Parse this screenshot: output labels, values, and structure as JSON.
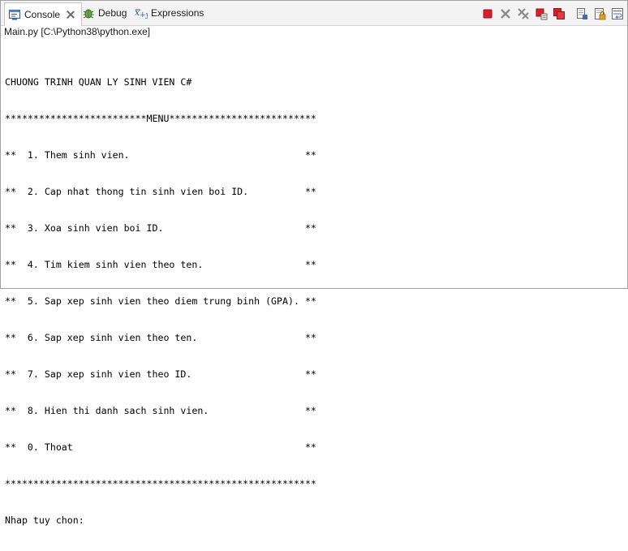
{
  "tabs": [
    {
      "label": "Console",
      "icon": "console-icon",
      "active": true
    },
    {
      "label": "Debug",
      "icon": "debug-bug-icon",
      "active": false
    },
    {
      "label": "Expressions",
      "icon": "expressions-icon",
      "active": false
    }
  ],
  "toolbar": [
    {
      "name": "terminate-button",
      "icon": "terminate-icon",
      "color": "#d8202c"
    },
    {
      "name": "remove-launch-button",
      "icon": "remove-launch-icon",
      "color": "#7a7a7a"
    },
    {
      "name": "remove-all-terminated-button",
      "icon": "remove-all-terminated-icon",
      "color": "#7a7a7a"
    },
    {
      "name": "stop-process-button",
      "icon": "stop-process-icon",
      "color": "#d8202c"
    },
    {
      "name": "terminate-all-button",
      "icon": "terminate-all-icon",
      "color": "#d8202c"
    },
    {
      "name": "clear-console-button",
      "icon": "clear-console-icon",
      "color": "#6a6a6a"
    },
    {
      "name": "scroll-lock-button",
      "icon": "scroll-lock-icon",
      "color": "#e0a020"
    },
    {
      "name": "word-wrap-button",
      "icon": "word-wrap-icon",
      "color": "#3c6fb0"
    }
  ],
  "process_label": "Main.py [C:\\Python38\\python.exe]",
  "console_lines": [
    "CHUONG TRINH QUAN LY SINH VIEN C#",
    "*************************MENU**************************",
    "**  1. Them sinh vien.                               **",
    "**  2. Cap nhat thong tin sinh vien boi ID.          **",
    "**  3. Xoa sinh vien boi ID.                         **",
    "**  4. Tim kiem sinh vien theo ten.                  **",
    "**  5. Sap xep sinh vien theo diem trung binh (GPA). **",
    "**  6. Sap xep sinh vien theo ten.                   **",
    "**  7. Sap xep sinh vien theo ID.                    **",
    "**  8. Hien thi danh sach sinh vien.                 **",
    "**  0. Thoat                                         **",
    "*******************************************************",
    "Nhap tuy chon: "
  ]
}
